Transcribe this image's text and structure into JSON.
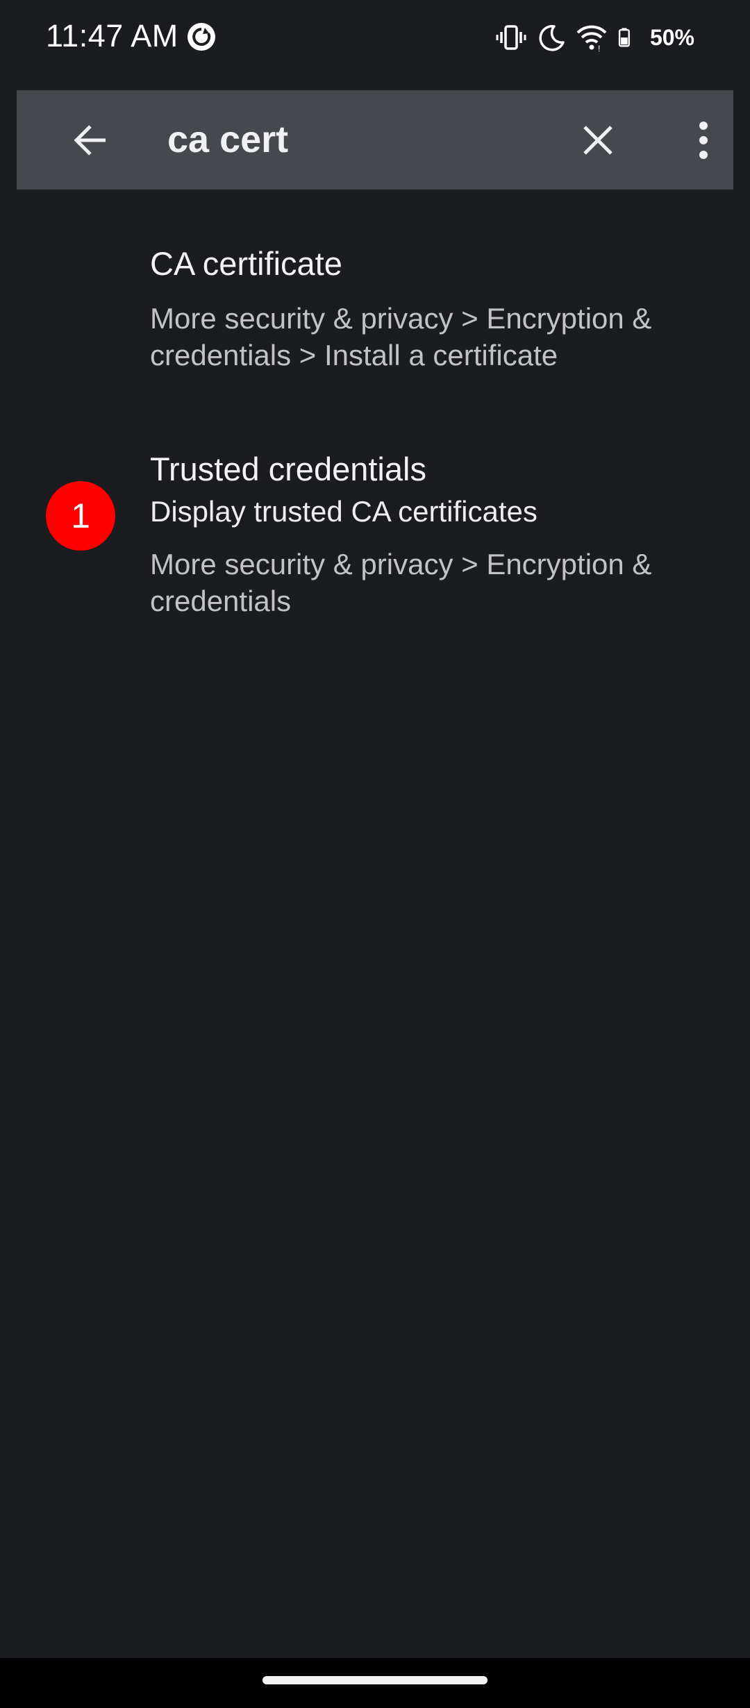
{
  "status_bar": {
    "time": "11:47 AM",
    "battery_text": "50%",
    "icons": [
      "sync-icon",
      "vibrate-icon",
      "do-not-disturb-moon-icon",
      "wifi-icon",
      "battery-icon"
    ]
  },
  "search_bar": {
    "back_icon": "arrow-back-icon",
    "query": "ca cert",
    "clear_icon": "close-icon",
    "more_icon": "more-vertical-icon"
  },
  "results": [
    {
      "title": "CA certificate",
      "path_line1": "More security & privacy > Encryption &",
      "path_line2": "credentials > Install a certificate"
    },
    {
      "title": "Trusted credentials",
      "subtitle": "Display trusted CA certificates",
      "path_line1": "More security & privacy > Encryption &",
      "path_line2": "credentials",
      "badge": "1"
    }
  ],
  "colors": {
    "background": "#1b1c20",
    "search_bar_bg": "#45484d",
    "badge": "#ff0000"
  }
}
